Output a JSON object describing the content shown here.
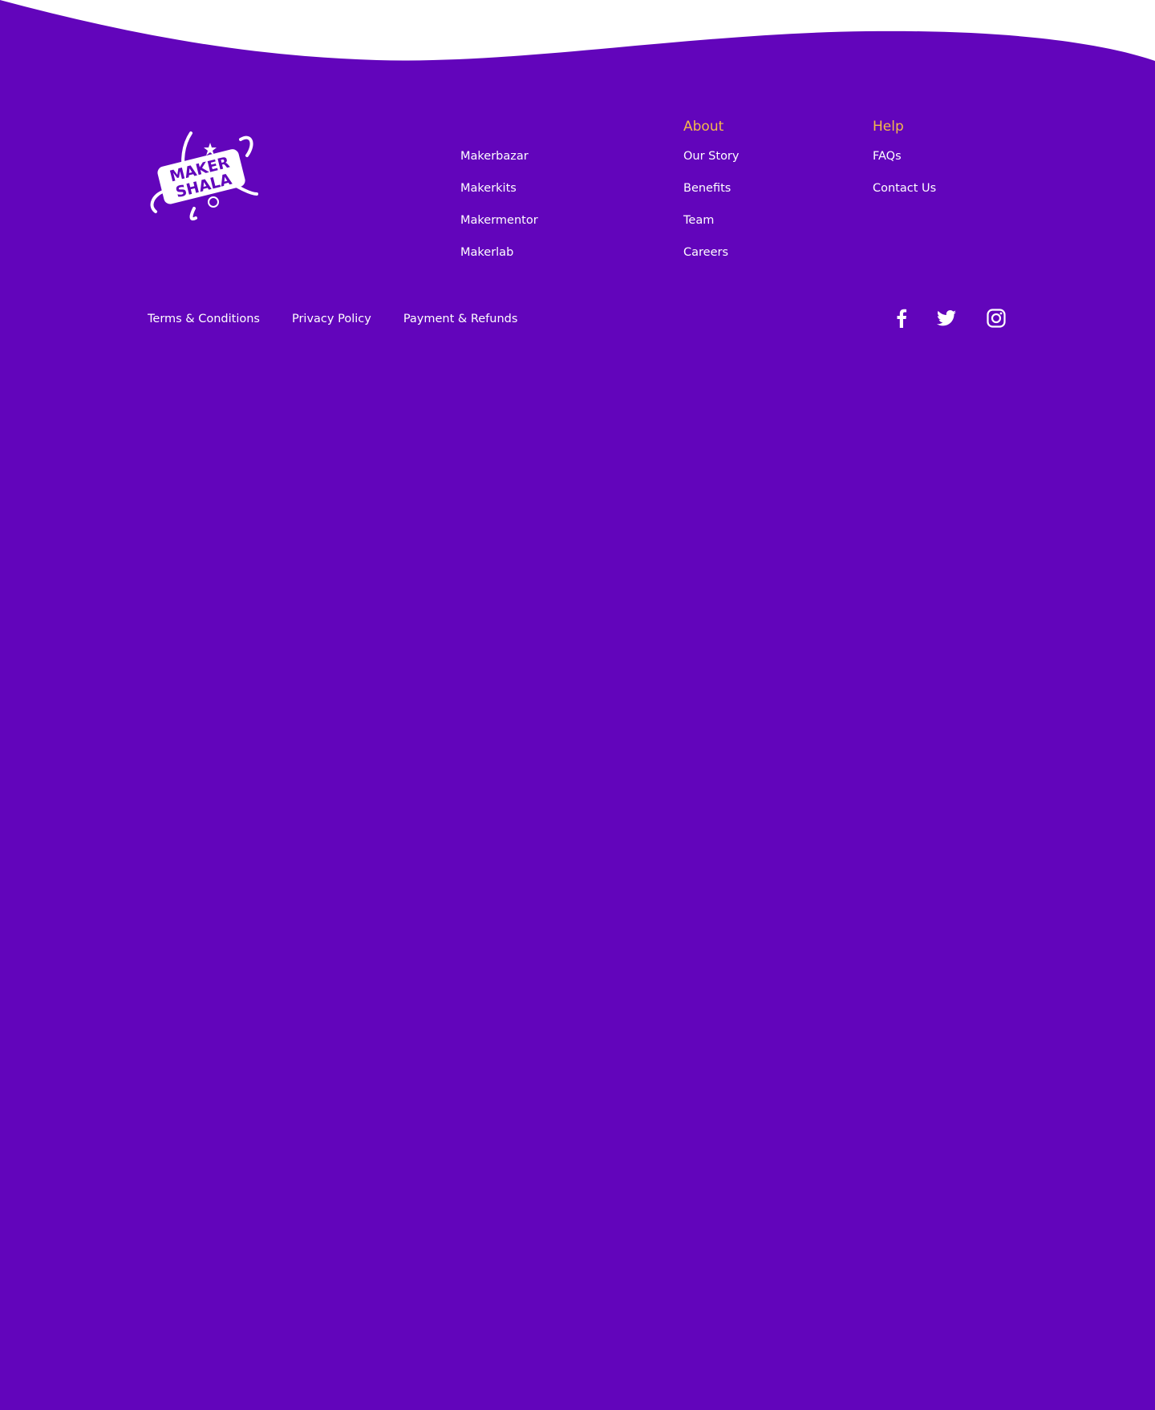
{
  "brand": {
    "name": "MAKER SHALA",
    "logo_line1": "MAKER",
    "logo_line2": "SHALA"
  },
  "colors": {
    "background": "#6205bb",
    "top_band": "#ffffff",
    "heading": "#f3ba4a",
    "link": "#ffffff"
  },
  "footer": {
    "products": {
      "items": [
        "Makerbazar",
        "Makerkits",
        "Makermentor",
        "Makerlab"
      ]
    },
    "about": {
      "heading": "About",
      "items": [
        "Our Story",
        "Benefits",
        "Team",
        "Careers"
      ]
    },
    "help": {
      "heading": "Help",
      "items": [
        "FAQs",
        "Contact Us"
      ]
    },
    "legal": {
      "items": [
        "Terms & Conditions",
        "Privacy Policy",
        "Payment & Refunds"
      ]
    },
    "social": [
      {
        "icon": "facebook-icon"
      },
      {
        "icon": "twitter-icon"
      },
      {
        "icon": "instagram-icon"
      }
    ]
  }
}
